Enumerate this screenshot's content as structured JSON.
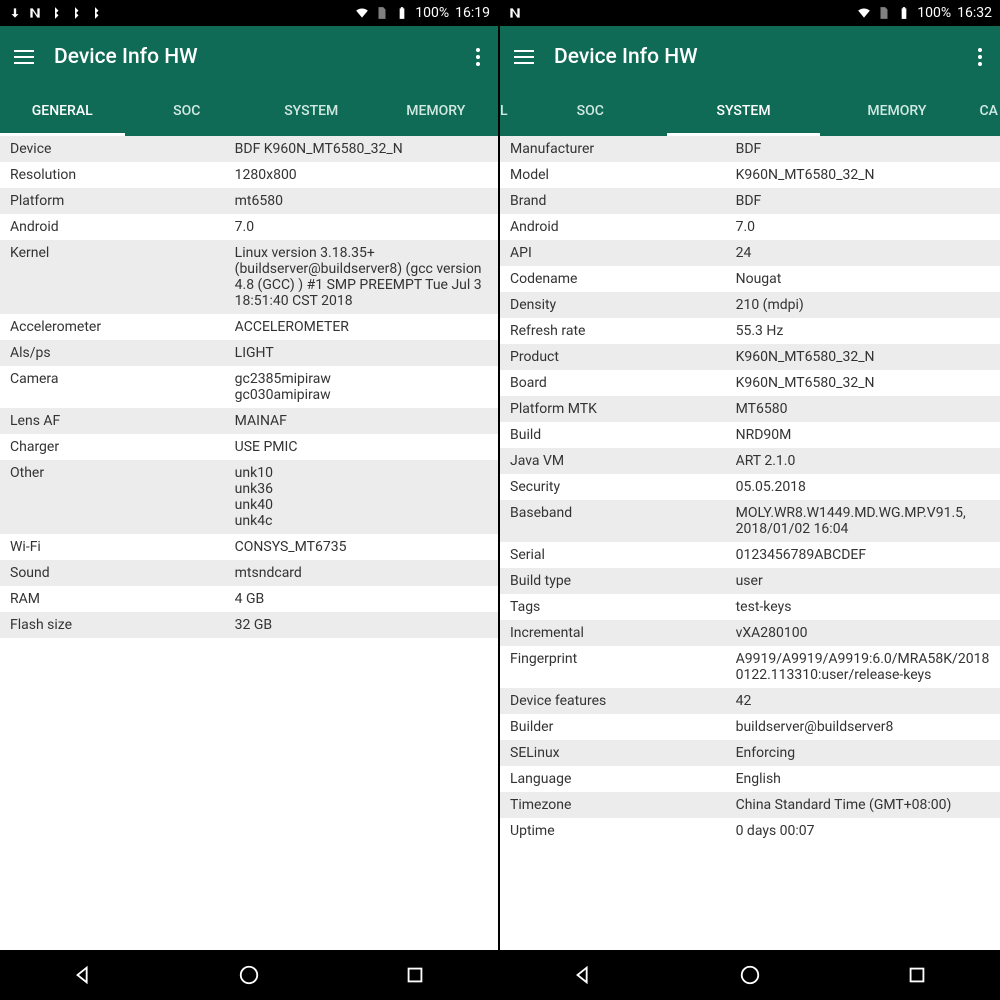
{
  "left": {
    "status": {
      "battery": "100%",
      "time": "16:19"
    },
    "app_title": "Device Info HW",
    "tabs": [
      "GENERAL",
      "SOC",
      "SYSTEM",
      "MEMORY"
    ],
    "active_tab": 0,
    "rows": [
      {
        "label": "Device",
        "value": "BDF K960N_MT6580_32_N"
      },
      {
        "label": "Resolution",
        "value": "1280x800"
      },
      {
        "label": "Platform",
        "value": "mt6580"
      },
      {
        "label": "Android",
        "value": "7.0"
      },
      {
        "label": "Kernel",
        "value": "Linux version 3.18.35+ (buildserver@buildserver8) (gcc version 4.8 (GCC) ) #1 SMP PREEMPT Tue Jul 3 18:51:40 CST 2018"
      },
      {
        "label": "Accelerometer",
        "value": "ACCELEROMETER"
      },
      {
        "label": "Als/ps",
        "value": "LIGHT"
      },
      {
        "label": "Camera",
        "value": "gc2385mipiraw\ngc030amipiraw"
      },
      {
        "label": "Lens AF",
        "value": "MAINAF"
      },
      {
        "label": "Charger",
        "value": "USE PMIC"
      },
      {
        "label": "Other",
        "value": "unk10\nunk36\nunk40\nunk4c"
      },
      {
        "label": "Wi-Fi",
        "value": "CONSYS_MT6735"
      },
      {
        "label": "Sound",
        "value": "mtsndcard"
      },
      {
        "label": "RAM",
        "value": "4 GB"
      },
      {
        "label": "Flash size",
        "value": "32 GB"
      }
    ]
  },
  "right": {
    "status": {
      "battery": "100%",
      "time": "16:32"
    },
    "app_title": "Device Info HW",
    "tabs_edge_left": "L",
    "tabs": [
      "SOC",
      "SYSTEM",
      "MEMORY"
    ],
    "tabs_edge_right": "CA",
    "active_tab": 1,
    "rows": [
      {
        "label": "Manufacturer",
        "value": "BDF"
      },
      {
        "label": "Model",
        "value": "K960N_MT6580_32_N"
      },
      {
        "label": "Brand",
        "value": "BDF"
      },
      {
        "label": "Android",
        "value": "7.0"
      },
      {
        "label": "API",
        "value": "24"
      },
      {
        "label": "Codename",
        "value": "Nougat"
      },
      {
        "label": "Density",
        "value": "210 (mdpi)"
      },
      {
        "label": "Refresh rate",
        "value": "55.3 Hz"
      },
      {
        "label": "Product",
        "value": "K960N_MT6580_32_N"
      },
      {
        "label": "Board",
        "value": "K960N_MT6580_32_N"
      },
      {
        "label": "Platform MTK",
        "value": "MT6580"
      },
      {
        "label": "Build",
        "value": "NRD90M"
      },
      {
        "label": "Java VM",
        "value": "ART 2.1.0"
      },
      {
        "label": "Security",
        "value": "05.05.2018"
      },
      {
        "label": "Baseband",
        "value": "MOLY.WR8.W1449.MD.WG.MP.V91.5, 2018/01/02 16:04"
      },
      {
        "label": "Serial",
        "value": "0123456789ABCDEF"
      },
      {
        "label": "Build type",
        "value": "user"
      },
      {
        "label": "Tags",
        "value": "test-keys"
      },
      {
        "label": "Incremental",
        "value": "vXA280100"
      },
      {
        "label": "Fingerprint",
        "value": "A9919/A9919/A9919:6.0/MRA58K/20180122.113310:user/release-keys"
      },
      {
        "label": "Device features",
        "value": "42"
      },
      {
        "label": "Builder",
        "value": "buildserver@buildserver8"
      },
      {
        "label": "SELinux",
        "value": "Enforcing"
      },
      {
        "label": "Language",
        "value": "English"
      },
      {
        "label": "Timezone",
        "value": "China Standard Time (GMT+08:00)"
      },
      {
        "label": "Uptime",
        "value": "0 days 00:07"
      }
    ]
  }
}
